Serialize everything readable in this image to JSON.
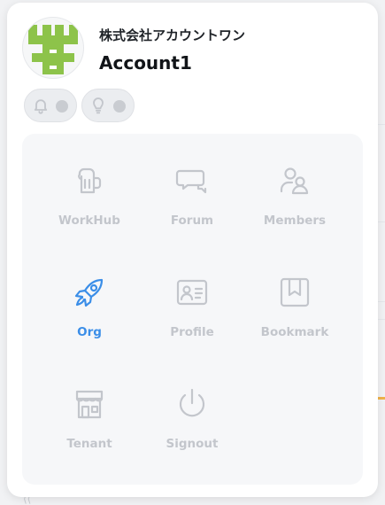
{
  "profile": {
    "company_name": "株式会社アカウントワン",
    "account_name": "Account1"
  },
  "toggles": [
    {
      "icon": "bell-icon",
      "state": "off"
    },
    {
      "icon": "lightbulb-icon",
      "state": "off"
    }
  ],
  "menu": {
    "items": [
      {
        "label": "WorkHub",
        "icon": "beer-mug-icon",
        "active": false
      },
      {
        "label": "Forum",
        "icon": "chat-bubbles-icon",
        "active": false
      },
      {
        "label": "Members",
        "icon": "users-icon",
        "active": false
      },
      {
        "label": "Org",
        "icon": "rocket-icon",
        "active": true
      },
      {
        "label": "Profile",
        "icon": "id-card-icon",
        "active": false
      },
      {
        "label": "Bookmark",
        "icon": "bookmark-icon",
        "active": false
      },
      {
        "label": "Tenant",
        "icon": "storefront-icon",
        "active": false
      },
      {
        "label": "Signout",
        "icon": "power-icon",
        "active": false
      }
    ]
  },
  "colors": {
    "active": "#3b8ee8",
    "inactive": "#c3c6cc",
    "avatar_green": "#8dc34a"
  }
}
